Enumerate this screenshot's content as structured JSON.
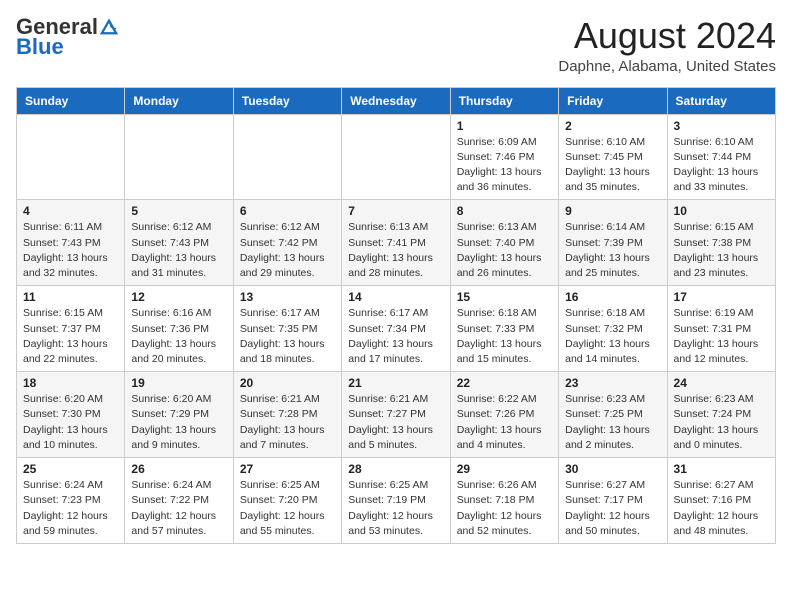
{
  "header": {
    "logo_general": "General",
    "logo_blue": "Blue",
    "month_title": "August 2024",
    "location": "Daphne, Alabama, United States"
  },
  "columns": [
    "Sunday",
    "Monday",
    "Tuesday",
    "Wednesday",
    "Thursday",
    "Friday",
    "Saturday"
  ],
  "weeks": [
    [
      {
        "day": "",
        "info": ""
      },
      {
        "day": "",
        "info": ""
      },
      {
        "day": "",
        "info": ""
      },
      {
        "day": "",
        "info": ""
      },
      {
        "day": "1",
        "info": "Sunrise: 6:09 AM\nSunset: 7:46 PM\nDaylight: 13 hours\nand 36 minutes."
      },
      {
        "day": "2",
        "info": "Sunrise: 6:10 AM\nSunset: 7:45 PM\nDaylight: 13 hours\nand 35 minutes."
      },
      {
        "day": "3",
        "info": "Sunrise: 6:10 AM\nSunset: 7:44 PM\nDaylight: 13 hours\nand 33 minutes."
      }
    ],
    [
      {
        "day": "4",
        "info": "Sunrise: 6:11 AM\nSunset: 7:43 PM\nDaylight: 13 hours\nand 32 minutes."
      },
      {
        "day": "5",
        "info": "Sunrise: 6:12 AM\nSunset: 7:43 PM\nDaylight: 13 hours\nand 31 minutes."
      },
      {
        "day": "6",
        "info": "Sunrise: 6:12 AM\nSunset: 7:42 PM\nDaylight: 13 hours\nand 29 minutes."
      },
      {
        "day": "7",
        "info": "Sunrise: 6:13 AM\nSunset: 7:41 PM\nDaylight: 13 hours\nand 28 minutes."
      },
      {
        "day": "8",
        "info": "Sunrise: 6:13 AM\nSunset: 7:40 PM\nDaylight: 13 hours\nand 26 minutes."
      },
      {
        "day": "9",
        "info": "Sunrise: 6:14 AM\nSunset: 7:39 PM\nDaylight: 13 hours\nand 25 minutes."
      },
      {
        "day": "10",
        "info": "Sunrise: 6:15 AM\nSunset: 7:38 PM\nDaylight: 13 hours\nand 23 minutes."
      }
    ],
    [
      {
        "day": "11",
        "info": "Sunrise: 6:15 AM\nSunset: 7:37 PM\nDaylight: 13 hours\nand 22 minutes."
      },
      {
        "day": "12",
        "info": "Sunrise: 6:16 AM\nSunset: 7:36 PM\nDaylight: 13 hours\nand 20 minutes."
      },
      {
        "day": "13",
        "info": "Sunrise: 6:17 AM\nSunset: 7:35 PM\nDaylight: 13 hours\nand 18 minutes."
      },
      {
        "day": "14",
        "info": "Sunrise: 6:17 AM\nSunset: 7:34 PM\nDaylight: 13 hours\nand 17 minutes."
      },
      {
        "day": "15",
        "info": "Sunrise: 6:18 AM\nSunset: 7:33 PM\nDaylight: 13 hours\nand 15 minutes."
      },
      {
        "day": "16",
        "info": "Sunrise: 6:18 AM\nSunset: 7:32 PM\nDaylight: 13 hours\nand 14 minutes."
      },
      {
        "day": "17",
        "info": "Sunrise: 6:19 AM\nSunset: 7:31 PM\nDaylight: 13 hours\nand 12 minutes."
      }
    ],
    [
      {
        "day": "18",
        "info": "Sunrise: 6:20 AM\nSunset: 7:30 PM\nDaylight: 13 hours\nand 10 minutes."
      },
      {
        "day": "19",
        "info": "Sunrise: 6:20 AM\nSunset: 7:29 PM\nDaylight: 13 hours\nand 9 minutes."
      },
      {
        "day": "20",
        "info": "Sunrise: 6:21 AM\nSunset: 7:28 PM\nDaylight: 13 hours\nand 7 minutes."
      },
      {
        "day": "21",
        "info": "Sunrise: 6:21 AM\nSunset: 7:27 PM\nDaylight: 13 hours\nand 5 minutes."
      },
      {
        "day": "22",
        "info": "Sunrise: 6:22 AM\nSunset: 7:26 PM\nDaylight: 13 hours\nand 4 minutes."
      },
      {
        "day": "23",
        "info": "Sunrise: 6:23 AM\nSunset: 7:25 PM\nDaylight: 13 hours\nand 2 minutes."
      },
      {
        "day": "24",
        "info": "Sunrise: 6:23 AM\nSunset: 7:24 PM\nDaylight: 13 hours\nand 0 minutes."
      }
    ],
    [
      {
        "day": "25",
        "info": "Sunrise: 6:24 AM\nSunset: 7:23 PM\nDaylight: 12 hours\nand 59 minutes."
      },
      {
        "day": "26",
        "info": "Sunrise: 6:24 AM\nSunset: 7:22 PM\nDaylight: 12 hours\nand 57 minutes."
      },
      {
        "day": "27",
        "info": "Sunrise: 6:25 AM\nSunset: 7:20 PM\nDaylight: 12 hours\nand 55 minutes."
      },
      {
        "day": "28",
        "info": "Sunrise: 6:25 AM\nSunset: 7:19 PM\nDaylight: 12 hours\nand 53 minutes."
      },
      {
        "day": "29",
        "info": "Sunrise: 6:26 AM\nSunset: 7:18 PM\nDaylight: 12 hours\nand 52 minutes."
      },
      {
        "day": "30",
        "info": "Sunrise: 6:27 AM\nSunset: 7:17 PM\nDaylight: 12 hours\nand 50 minutes."
      },
      {
        "day": "31",
        "info": "Sunrise: 6:27 AM\nSunset: 7:16 PM\nDaylight: 12 hours\nand 48 minutes."
      }
    ]
  ]
}
